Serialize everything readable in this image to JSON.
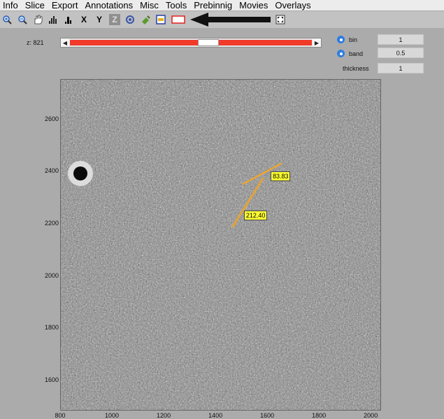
{
  "menu": [
    "Info",
    "Slice",
    "Export",
    "Annotations",
    "Misc",
    "Tools",
    "Prebinnig",
    "Movies",
    "Overlays"
  ],
  "toolbar": {
    "x_label": "X",
    "y_label": "Y",
    "z_label": "Z"
  },
  "slice": {
    "z_label": "z:",
    "z_value": "821",
    "position": 0.57
  },
  "options": {
    "bin_label": "bin",
    "bin_value": "1",
    "band_label": "band",
    "band_value": "0.5",
    "thickness_label": "thickness",
    "thickness_value": "1"
  },
  "axes": {
    "y_ticks": [
      "2600",
      "2400",
      "2200",
      "2000",
      "1800",
      "1600"
    ],
    "x_ticks": [
      "800",
      "1000",
      "1200",
      "1400",
      "1600",
      "1800",
      "2000"
    ],
    "x_range": [
      800,
      2040
    ],
    "y_range": [
      1485,
      2755
    ]
  },
  "annotations": [
    {
      "label": "83.83"
    },
    {
      "label": "212.40"
    }
  ],
  "colors": {
    "slider_track": "#f03a2a",
    "accent": "#2f7de1",
    "annotation_line": "#f5a623",
    "annotation_box": "#ffff33"
  }
}
